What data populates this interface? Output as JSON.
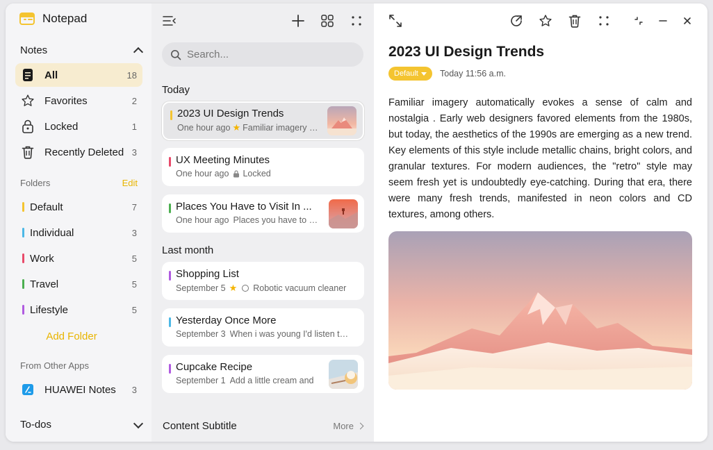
{
  "app": {
    "title": "Notepad"
  },
  "sidebar": {
    "notes_section": "Notes",
    "nav": [
      {
        "label": "All",
        "count": "18",
        "icon": "notes-icon",
        "active": true
      },
      {
        "label": "Favorites",
        "count": "2",
        "icon": "star-outline-icon"
      },
      {
        "label": "Locked",
        "count": "1",
        "icon": "lock-icon"
      },
      {
        "label": "Recently Deleted",
        "count": "3",
        "icon": "trash-icon"
      }
    ],
    "folders_heading": "Folders",
    "edit_label": "Edit",
    "folders": [
      {
        "label": "Default",
        "count": "7",
        "color": "#f4c430"
      },
      {
        "label": "Individual",
        "count": "3",
        "color": "#4cb8e6"
      },
      {
        "label": "Work",
        "count": "5",
        "color": "#e84a6a"
      },
      {
        "label": "Travel",
        "count": "5",
        "color": "#4caf50"
      },
      {
        "label": "Lifestyle",
        "count": "5",
        "color": "#b05be0"
      }
    ],
    "add_folder_label": "Add Folder",
    "other_apps_heading": "From Other Apps",
    "other_apps": [
      {
        "label": "HUAWEI Notes",
        "count": "3"
      }
    ],
    "todos_section": "To-dos"
  },
  "list": {
    "search_placeholder": "Search...",
    "groups": [
      {
        "title": "Today"
      },
      {
        "title": "Last month"
      }
    ],
    "notes": [
      {
        "title": "2023 UI Design Trends",
        "time": "One hour ago",
        "preview": "Familiar imagery automatically evokes",
        "color": "#f4c430",
        "selected": true
      },
      {
        "title": "UX Meeting Minutes",
        "time": "One hour ago",
        "preview": "Locked",
        "color": "#e84a6a"
      },
      {
        "title": "Places You Have to Visit In ...",
        "time": "One hour ago",
        "preview": "Places you have to visit",
        "color": "#4caf50"
      },
      {
        "title": "Shopping List",
        "time": "September 5",
        "preview": "Robotic vacuum cleaner",
        "color": "#b05be0"
      },
      {
        "title": "Yesterday Once More",
        "time": "September 3",
        "preview": "When i was young I'd listen to the radio",
        "color": "#4cb8e6"
      },
      {
        "title": "Cupcake Recipe",
        "time": "September 1",
        "preview": "Add a little cream and",
        "color": "#b05be0"
      }
    ],
    "footer_title": "Content Subtitle",
    "footer_more": "More"
  },
  "detail": {
    "title": "2023 UI Design Trends",
    "tag": "Default",
    "timestamp": "Today 11:56 a.m.",
    "body": "Familiar imagery automatically evokes a sense of calm and nostalgia . Early web designers favored elements from the 1980s, but today, the aesthetics of the 1990s are emerging as a new trend. Key elements of this style include metallic chains, bright colors, and granular textures. For modern audiences, the \"retro\" style may seem fresh yet is undoubtedly eye-catching. During that era, there were many fresh trends, manifested in neon colors and CD textures, among others."
  },
  "colors": {
    "accent": "#f4c430",
    "link": "#e8b400"
  }
}
